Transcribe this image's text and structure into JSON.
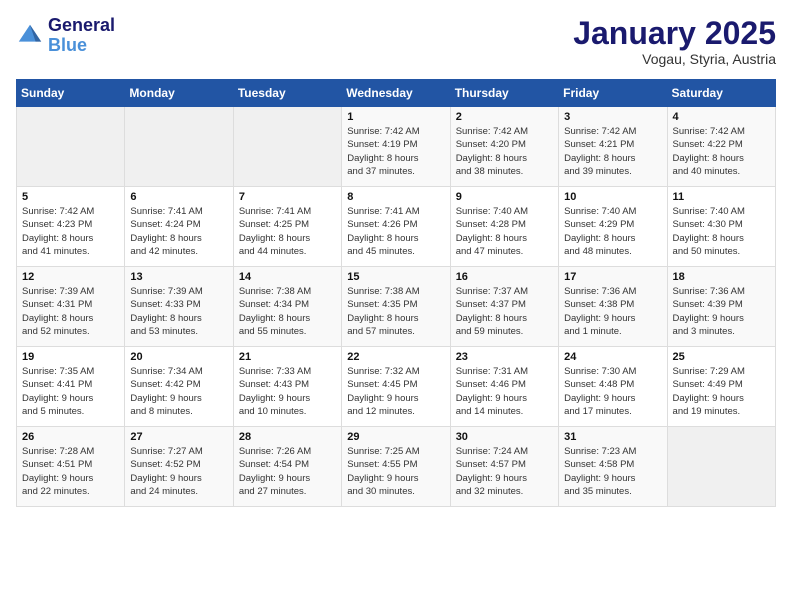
{
  "logo": {
    "line1": "General",
    "line2": "Blue"
  },
  "header": {
    "title": "January 2025",
    "subtitle": "Vogau, Styria, Austria"
  },
  "days_of_week": [
    "Sunday",
    "Monday",
    "Tuesday",
    "Wednesday",
    "Thursday",
    "Friday",
    "Saturday"
  ],
  "weeks": [
    [
      {
        "day": "",
        "info": ""
      },
      {
        "day": "",
        "info": ""
      },
      {
        "day": "",
        "info": ""
      },
      {
        "day": "1",
        "info": "Sunrise: 7:42 AM\nSunset: 4:19 PM\nDaylight: 8 hours\nand 37 minutes."
      },
      {
        "day": "2",
        "info": "Sunrise: 7:42 AM\nSunset: 4:20 PM\nDaylight: 8 hours\nand 38 minutes."
      },
      {
        "day": "3",
        "info": "Sunrise: 7:42 AM\nSunset: 4:21 PM\nDaylight: 8 hours\nand 39 minutes."
      },
      {
        "day": "4",
        "info": "Sunrise: 7:42 AM\nSunset: 4:22 PM\nDaylight: 8 hours\nand 40 minutes."
      }
    ],
    [
      {
        "day": "5",
        "info": "Sunrise: 7:42 AM\nSunset: 4:23 PM\nDaylight: 8 hours\nand 41 minutes."
      },
      {
        "day": "6",
        "info": "Sunrise: 7:41 AM\nSunset: 4:24 PM\nDaylight: 8 hours\nand 42 minutes."
      },
      {
        "day": "7",
        "info": "Sunrise: 7:41 AM\nSunset: 4:25 PM\nDaylight: 8 hours\nand 44 minutes."
      },
      {
        "day": "8",
        "info": "Sunrise: 7:41 AM\nSunset: 4:26 PM\nDaylight: 8 hours\nand 45 minutes."
      },
      {
        "day": "9",
        "info": "Sunrise: 7:40 AM\nSunset: 4:28 PM\nDaylight: 8 hours\nand 47 minutes."
      },
      {
        "day": "10",
        "info": "Sunrise: 7:40 AM\nSunset: 4:29 PM\nDaylight: 8 hours\nand 48 minutes."
      },
      {
        "day": "11",
        "info": "Sunrise: 7:40 AM\nSunset: 4:30 PM\nDaylight: 8 hours\nand 50 minutes."
      }
    ],
    [
      {
        "day": "12",
        "info": "Sunrise: 7:39 AM\nSunset: 4:31 PM\nDaylight: 8 hours\nand 52 minutes."
      },
      {
        "day": "13",
        "info": "Sunrise: 7:39 AM\nSunset: 4:33 PM\nDaylight: 8 hours\nand 53 minutes."
      },
      {
        "day": "14",
        "info": "Sunrise: 7:38 AM\nSunset: 4:34 PM\nDaylight: 8 hours\nand 55 minutes."
      },
      {
        "day": "15",
        "info": "Sunrise: 7:38 AM\nSunset: 4:35 PM\nDaylight: 8 hours\nand 57 minutes."
      },
      {
        "day": "16",
        "info": "Sunrise: 7:37 AM\nSunset: 4:37 PM\nDaylight: 8 hours\nand 59 minutes."
      },
      {
        "day": "17",
        "info": "Sunrise: 7:36 AM\nSunset: 4:38 PM\nDaylight: 9 hours\nand 1 minute."
      },
      {
        "day": "18",
        "info": "Sunrise: 7:36 AM\nSunset: 4:39 PM\nDaylight: 9 hours\nand 3 minutes."
      }
    ],
    [
      {
        "day": "19",
        "info": "Sunrise: 7:35 AM\nSunset: 4:41 PM\nDaylight: 9 hours\nand 5 minutes."
      },
      {
        "day": "20",
        "info": "Sunrise: 7:34 AM\nSunset: 4:42 PM\nDaylight: 9 hours\nand 8 minutes."
      },
      {
        "day": "21",
        "info": "Sunrise: 7:33 AM\nSunset: 4:43 PM\nDaylight: 9 hours\nand 10 minutes."
      },
      {
        "day": "22",
        "info": "Sunrise: 7:32 AM\nSunset: 4:45 PM\nDaylight: 9 hours\nand 12 minutes."
      },
      {
        "day": "23",
        "info": "Sunrise: 7:31 AM\nSunset: 4:46 PM\nDaylight: 9 hours\nand 14 minutes."
      },
      {
        "day": "24",
        "info": "Sunrise: 7:30 AM\nSunset: 4:48 PM\nDaylight: 9 hours\nand 17 minutes."
      },
      {
        "day": "25",
        "info": "Sunrise: 7:29 AM\nSunset: 4:49 PM\nDaylight: 9 hours\nand 19 minutes."
      }
    ],
    [
      {
        "day": "26",
        "info": "Sunrise: 7:28 AM\nSunset: 4:51 PM\nDaylight: 9 hours\nand 22 minutes."
      },
      {
        "day": "27",
        "info": "Sunrise: 7:27 AM\nSunset: 4:52 PM\nDaylight: 9 hours\nand 24 minutes."
      },
      {
        "day": "28",
        "info": "Sunrise: 7:26 AM\nSunset: 4:54 PM\nDaylight: 9 hours\nand 27 minutes."
      },
      {
        "day": "29",
        "info": "Sunrise: 7:25 AM\nSunset: 4:55 PM\nDaylight: 9 hours\nand 30 minutes."
      },
      {
        "day": "30",
        "info": "Sunrise: 7:24 AM\nSunset: 4:57 PM\nDaylight: 9 hours\nand 32 minutes."
      },
      {
        "day": "31",
        "info": "Sunrise: 7:23 AM\nSunset: 4:58 PM\nDaylight: 9 hours\nand 35 minutes."
      },
      {
        "day": "",
        "info": ""
      }
    ]
  ]
}
